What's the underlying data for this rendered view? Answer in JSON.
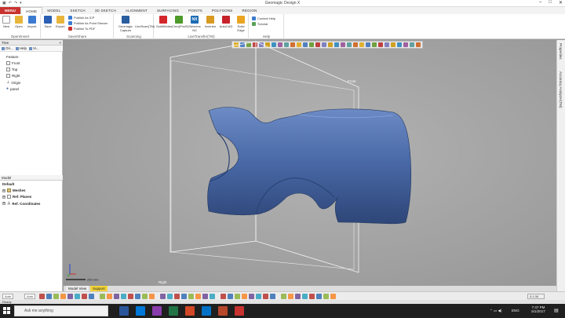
{
  "app": {
    "title": "Geomagic Design X",
    "quick_access": [
      "▣",
      "↶",
      "↷",
      "▾"
    ],
    "window_buttons": [
      "–",
      "□",
      "✕"
    ]
  },
  "tabs": [
    {
      "label": "MENU",
      "kind": "menu"
    },
    {
      "label": "HOME",
      "kind": "active"
    },
    {
      "label": "MODEL",
      "kind": ""
    },
    {
      "label": "SKETCH",
      "kind": ""
    },
    {
      "label": "3D SKETCH",
      "kind": ""
    },
    {
      "label": "ALIGNMENT",
      "kind": ""
    },
    {
      "label": "SURFACING",
      "kind": ""
    },
    {
      "label": "POINTS",
      "kind": ""
    },
    {
      "label": "POLYGONS",
      "kind": ""
    },
    {
      "label": "REGION",
      "kind": ""
    }
  ],
  "ribbon": {
    "open_insert": {
      "label": "Open/Insert",
      "buttons": [
        "New",
        "Open",
        "Import"
      ]
    },
    "save_share": {
      "label": "Save/Share",
      "buttons": [
        "Save",
        "Export"
      ],
      "small": [
        "Publish As ICP",
        "Publish As Point Stream",
        "Publish To PDF"
      ]
    },
    "scanning": {
      "label": "Scanning",
      "buttons": [
        "Geomagic Capture"
      ]
    },
    "livetransfer": {
      "label": "LiveTransfer(TM)",
      "buttons": [
        "SolidWorks",
        "Creo(Pro/E)",
        "Siemens NX",
        "Inventor",
        "AutoCAD",
        "Solid Edge"
      ]
    },
    "help": {
      "label": "Help",
      "small": [
        "Context Help",
        "Tutorial"
      ]
    },
    "colors": {
      "new": "#ffffff",
      "open": "#e8b53b",
      "import": "#3b7bd1",
      "save": "#2b5fb3",
      "export": "#e8b53b",
      "capture": "#2a5d9f",
      "solidworks": "#d3262b",
      "creo": "#4e9a2a",
      "nx": "#1b6bb5",
      "inventor": "#d99a22",
      "autocad": "#c7222a",
      "solidedge": "#e9a520"
    },
    "scan_text": "LineScan(TM)",
    "nx_text": "NX"
  },
  "left_panel": {
    "tree_header": "Tree",
    "tree_tools": [
      "Ori...",
      "Help",
      "Vi..."
    ],
    "feature_label": "Feature",
    "feature_items": [
      "Front",
      "Top",
      "Right",
      "Origin",
      "panel"
    ],
    "model_header": "Model",
    "model_default": "Default",
    "model_items": [
      "Meshes",
      "Ref. Planes",
      "Ref. Coordinates"
    ]
  },
  "right_strip": {
    "tabs": [
      "Properties",
      "Accuracy Analyzer(TM)"
    ]
  },
  "viewport": {
    "plane_labels": [
      "Front",
      "Right"
    ],
    "scale_label": "250 mm",
    "body_color": "#4a6aa8",
    "toolbar_colors": [
      "#e0b030",
      "#5080c0",
      "#70a040",
      "#c04040",
      "#8080c0",
      "#d0a020",
      "#4090c0",
      "#a060a0",
      "#60a0a0",
      "#d07030"
    ]
  },
  "bottom_tabs": [
    "Model View",
    "Support"
  ],
  "statusbar": {
    "select_a": "Auto",
    "select_b": "Auto",
    "ready": "Ready",
    "time_readout": "0:1:36"
  },
  "taskbar": {
    "search_placeholder": "Ask me anything",
    "clock_time": "7:47 PM",
    "clock_date": "5/1/2017",
    "lang": "ENG",
    "app_colors": [
      "#2b579a",
      "#0078d7",
      "#8a3cad",
      "#217346",
      "#d24726",
      "#0072c6",
      "#b7472a",
      "#c8332f"
    ]
  }
}
